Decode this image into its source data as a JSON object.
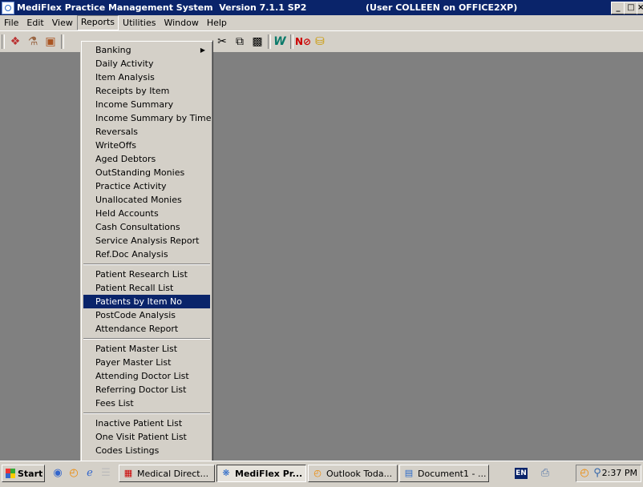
{
  "window": {
    "title": "MediFlex Practice Management System  Version 7.1.1 SP2",
    "user_info": "(User COLLEEN on OFFICE2XP)",
    "controls": [
      "_",
      "□",
      "×"
    ]
  },
  "menubar": [
    "File",
    "Edit",
    "View",
    "Reports",
    "Utilities",
    "Window",
    "Help"
  ],
  "reports_menu": {
    "groups": [
      [
        "Banking",
        "Daily Activity",
        "Item Analysis",
        "Receipts by Item",
        "Income Summary",
        "Income Summary by Time",
        "Reversals",
        "WriteOffs",
        "Aged Debtors",
        "OutStanding Monies",
        "Practice Activity",
        "Unallocated Monies",
        "Held Accounts",
        "Cash Consultations",
        "Service Analysis Report",
        "Ref.Doc Analysis"
      ],
      [
        "Patient Research List",
        "Patient Recall List",
        "Patients by Item No",
        "PostCode Analysis",
        "Attendance Report"
      ],
      [
        "Patient Master List",
        "Payer Master List",
        "Attending Doctor List",
        "Referring Doctor List",
        "Fees List"
      ],
      [
        "Inactive Patient List",
        "One Visit Patient List",
        "Codes Listings"
      ]
    ],
    "highlighted": "Patients by Item No",
    "submenu_item": "Banking"
  },
  "toolbar": {
    "icons": [
      "patients-icon",
      "doctor-icon",
      "book-icon",
      "cut-icon",
      "copy-icon",
      "paste-icon",
      "word-icon",
      "no-entry-icon",
      "lock-icon"
    ]
  },
  "taskbar": {
    "start_label": "Start",
    "tasks": [
      {
        "label": "Medical Direct...",
        "active": false
      },
      {
        "label": "MediFlex Pr...",
        "active": true
      },
      {
        "label": "Outlook Toda...",
        "active": false
      },
      {
        "label": "Document1 - ...",
        "active": false
      }
    ],
    "language": "EN",
    "clock": "2:37 PM"
  }
}
